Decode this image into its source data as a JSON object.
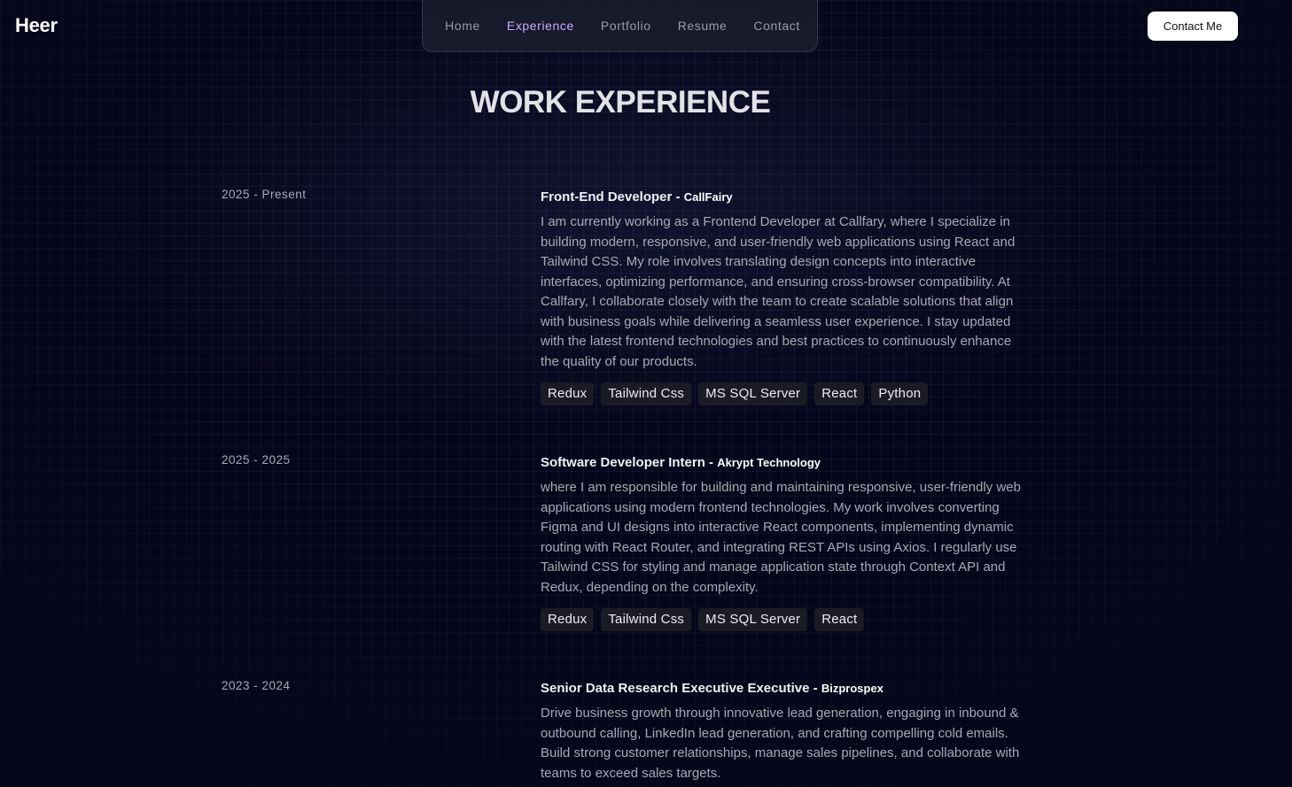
{
  "header": {
    "logo": "Heer",
    "nav": [
      "Home",
      "Experience",
      "Portfolio",
      "Resume",
      "Contact"
    ],
    "active_nav": "Experience",
    "contact_button": "Contact Me"
  },
  "main": {
    "title": "WORK EXPERIENCE",
    "experiences": [
      {
        "period": "2025 - Present",
        "role": "Front-End Developer",
        "separator": " - ",
        "company": "CallFairy",
        "description": "I am currently working as a Frontend Developer at Callfary, where I specialize in building modern, responsive, and user-friendly web applications using React and Tailwind CSS. My role involves translating design concepts into interactive interfaces, optimizing performance, and ensuring cross-browser compatibility. At Callfary, I collaborate closely with the team to create scalable solutions that align with business goals while delivering a seamless user experience. I stay updated with the latest frontend technologies and best practices to continuously enhance the quality of our products.",
        "tags": [
          "Redux",
          "Tailwind Css",
          "MS SQL Server",
          "React",
          "Python"
        ]
      },
      {
        "period": "2025 - 2025",
        "role": "Software Developer Intern",
        "separator": " - ",
        "company": "Akrypt Technology",
        "description": "where I am responsible for building and maintaining responsive, user-friendly web applications using modern frontend technologies. My work involves converting Figma and UI designs into interactive React components, implementing dynamic routing with React Router, and integrating REST APIs using Axios. I regularly use Tailwind CSS for styling and manage application state through Context API and Redux, depending on the complexity.",
        "tags": [
          "Redux",
          "Tailwind Css",
          "MS SQL Server",
          "React"
        ]
      },
      {
        "period": "2023 - 2024",
        "role": "Senior Data Research Executive Executive",
        "separator": " - ",
        "company": "Bizprospex",
        "description": "Drive business growth through innovative lead generation, engaging in inbound & outbound calling, LinkedIn lead generation, and crafting compelling cold emails. Build strong customer relationships, manage sales pipelines, and collaborate with teams to exceed sales targets.",
        "tags": []
      }
    ]
  }
}
